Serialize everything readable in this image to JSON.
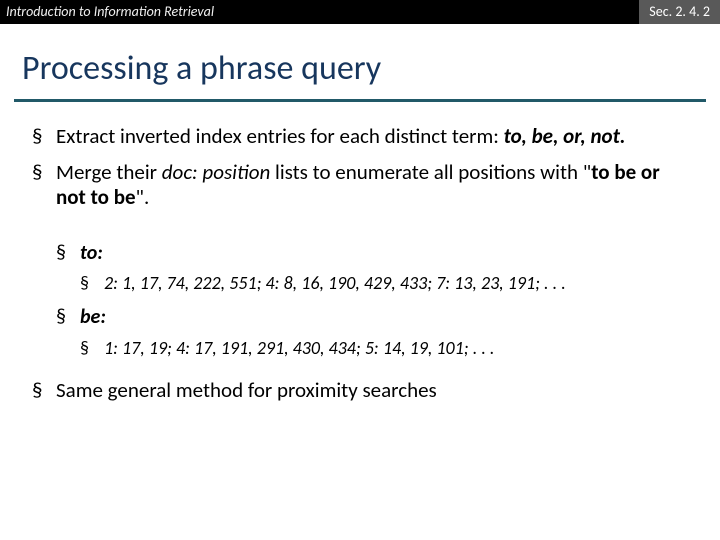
{
  "topbar": {
    "left": "Introduction to Information Retrieval",
    "right": "Sec. 2. 4. 2"
  },
  "title": "Processing a phrase query",
  "bullets": {
    "b1_prefix": "Extract inverted index entries for each distinct term: ",
    "b1_terms": "to, be, or, not.",
    "b2_prefix": "Merge their ",
    "b2_italic": "doc: position",
    "b2_mid": " lists to enumerate all positions with \"",
    "b2_phrase": "to be or not to be",
    "b2_suffix": "\".",
    "to_label": "to:",
    "to_vals_1": "2: 1, 17, 74, 222, 551; ",
    "to_vals_2": "4: 8, 16, 190, 429, 433; ",
    "to_vals_3": "7: 13, 23, 191; ",
    "to_tail": ". . .",
    "be_label": "be:",
    "be_vals_1": "1: 17, 19; ",
    "be_vals_2": "4: 17, 191, 291, 430, 434; ",
    "be_vals_3": "5: 14, 19, 101; ",
    "be_tail": ". . .",
    "b5": "Same general method for proximity searches"
  }
}
